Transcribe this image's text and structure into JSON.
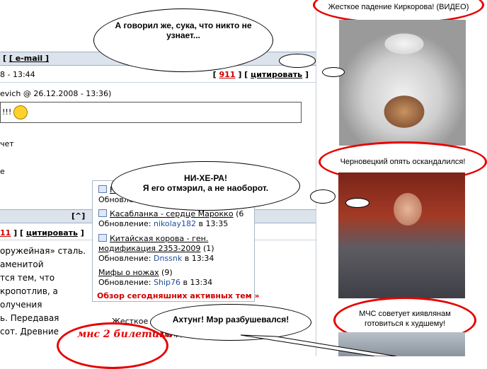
{
  "forum": {
    "header_links": "[ e-mail ]",
    "post_time": "8 - 13:44",
    "post_actions": {
      "number": "911",
      "quote": "цитировать"
    },
    "quote_author": "evich @ 26.12.2008 - 13:36)",
    "quote_text": "!!!",
    "text_lines": [
      "чет",
      "е"
    ],
    "scroll_up": "[^]",
    "second_post_actions": {
      "number": "11",
      "quote": "цитировать"
    },
    "body_lines": [
      "оружейная» сталь.",
      "аменитой",
      "тся тем, что",
      "кропотлив, а",
      "олучения",
      "ь. Передавая",
      "сот. Древние"
    ],
    "bottom_text": "Жесткое г",
    "bottom_text2": "(ВИДЕО)",
    "stamp_text": "мнс 2 билетика"
  },
  "active_topics": {
    "items": [
      {
        "title": "Н",
        "updated_label": "Обновление"
      },
      {
        "title": "Касабланка - сердце Марокко",
        "count": "(6",
        "updated_label": "Обновление:",
        "user": "nikolay182",
        "time": "в 13:35"
      },
      {
        "title": "Китайская корова - ген. модификация 2353-2009",
        "count": "(1)",
        "updated_label": "Обновление:",
        "user": "Dnssnk",
        "time": "в 13:34"
      },
      {
        "title": "Мифы о ножах",
        "count": "(9)",
        "updated_label": "Обновление:",
        "user": "Ship76",
        "time": "в 13:34"
      }
    ],
    "overview_link": "Обзор сегодняшних активных тем »"
  },
  "sidebar": {
    "headline1": "Жесткое падение Киркорова! (ВИДЕО)",
    "headline2": "Черновецкий опять оскандалился!",
    "headline3": "МЧС советует киявлянам готовиться к худшему!"
  },
  "bubbles": {
    "b1": "А говорил же, сука, что никто не узнает...",
    "b2_line1": "НИ-ХЕ-РА!",
    "b2_line2": "Я его отмэрил, а не наоборот.",
    "b3": "Ахтунг! Мэр разбушевался!"
  }
}
